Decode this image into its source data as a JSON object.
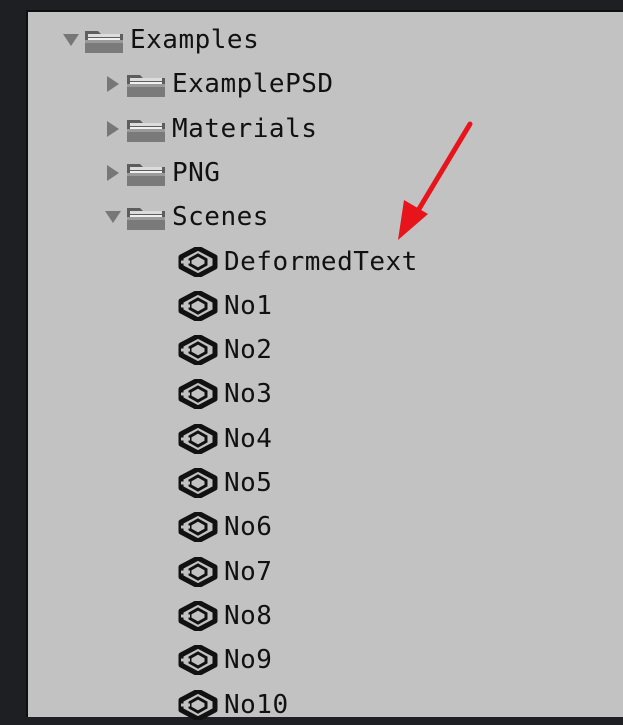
{
  "tree": {
    "root": {
      "label": "Examples",
      "expanded": true
    },
    "folders": [
      {
        "label": "ExamplePSD",
        "expanded": false
      },
      {
        "label": "Materials",
        "expanded": false
      },
      {
        "label": "PNG",
        "expanded": false
      },
      {
        "label": "Scenes",
        "expanded": true
      }
    ],
    "scenes": [
      "DeformedText",
      "No1",
      "No2",
      "No3",
      "No4",
      "No5",
      "No6",
      "No7",
      "No8",
      "No9",
      "No10"
    ]
  },
  "colors": {
    "background": "#1e1f22",
    "panel": "#c2c2c2",
    "annotation_arrow": "#e8141c"
  }
}
